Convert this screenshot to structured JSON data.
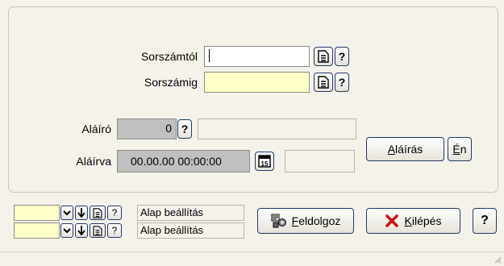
{
  "form": {
    "sorszamtol_label": "Sorszámtól",
    "sorszamtol_value": "",
    "sorszamig_label": "Sorszámig",
    "sorszamig_value": "",
    "alairo_label": "Aláíró",
    "alairo_value": "0",
    "alairo_name": "",
    "alairva_label": "Aláírva",
    "alairva_value": "00.00.00 00:00:00",
    "alairva_extra": "",
    "help_glyph": "?",
    "calendar_day": "15"
  },
  "side_buttons": {
    "alairas_prefix": "",
    "alairas_hot": "A",
    "alairas_rest": "láírás",
    "en_hot": "É",
    "en_rest": "n"
  },
  "footer": {
    "rows": [
      {
        "value": "",
        "setting_label": "Alap beállítás"
      },
      {
        "value": "",
        "setting_label": "Alap beállítás"
      }
    ],
    "feldolgoz_hot": "F",
    "feldolgoz_rest": "eldolgoz",
    "kilepes_hot": "K",
    "kilepes_rest": "ilépés",
    "help_glyph": "?"
  },
  "colors": {
    "accent": "#1e3a6b",
    "required_field": "#ffffc8",
    "close_icon": "#cc1111"
  }
}
